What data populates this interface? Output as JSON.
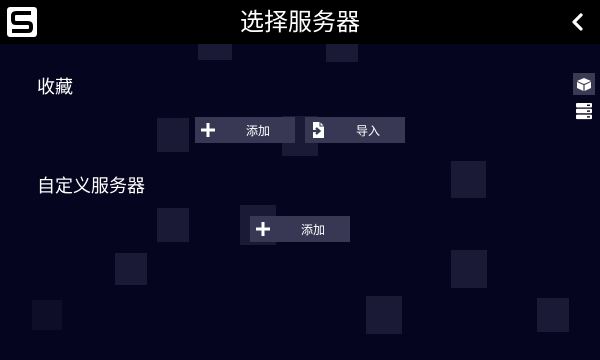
{
  "header": {
    "title": "选择服务器",
    "logo_icon": "s-logo-icon",
    "back_icon": "chevron-left-icon"
  },
  "favorites": {
    "title": "收藏",
    "add_label": "添加",
    "import_label": "导入"
  },
  "custom_servers": {
    "title": "自定义服务器",
    "add_label": "添加"
  },
  "side_icons": [
    "box-icon",
    "server-list-icon"
  ],
  "colors": {
    "background": "#06051f",
    "topbar": "#000000",
    "button": "#383855",
    "text": "#ffffff"
  }
}
